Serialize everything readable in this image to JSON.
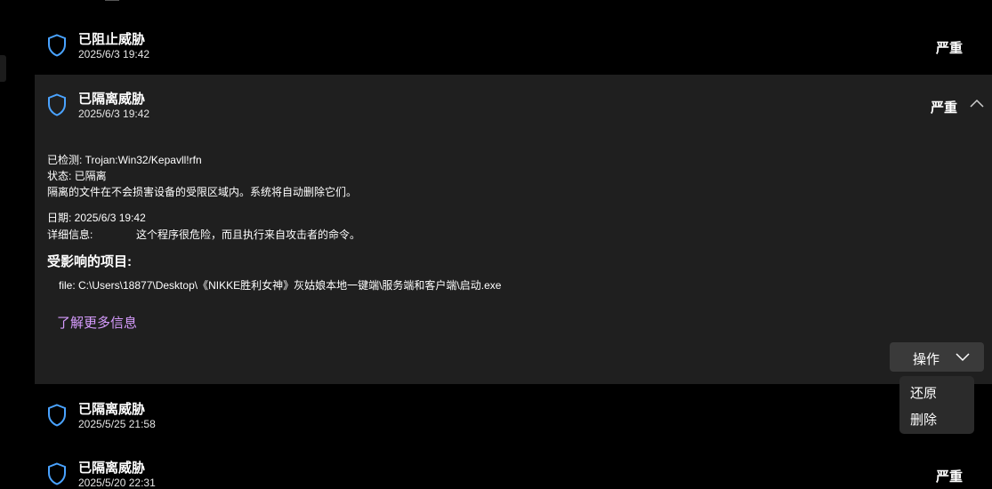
{
  "threats": [
    {
      "title": "已阻止威胁",
      "date": "2025/6/3 19:42",
      "severity": "严重"
    },
    {
      "title": "已隔离威胁",
      "date": "2025/6/3 19:42",
      "severity": "严重"
    },
    {
      "title": "已隔离威胁",
      "date": "2025/5/25 21:58",
      "severity": ""
    },
    {
      "title": "已隔离威胁",
      "date": "2025/5/20 22:31",
      "severity": "严重"
    }
  ],
  "details": {
    "detected": "已检测: Trojan:Win32/Kepavll!rfn",
    "status": "状态: 已隔离",
    "status_note": "隔离的文件在不会损害设备的受限区域内。系统将自动删除它们。",
    "date": "日期: 2025/6/3 19:42",
    "info_label": "详细信息:",
    "info_value": "这个程序很危险，而且执行来自攻击者的命令。",
    "affected_title": "受影响的项目:",
    "file": "file: C:\\Users\\18877\\Desktop\\《NIKKE胜利女神》灰姑娘本地一键端\\服务端和客户端\\启动.exe",
    "learn_more": "了解更多信息"
  },
  "actions": {
    "button_label": "操作",
    "menu": [
      "还原",
      "删除"
    ]
  },
  "colors": {
    "accent": "#d79cff",
    "shield": "#4aa3ff"
  }
}
